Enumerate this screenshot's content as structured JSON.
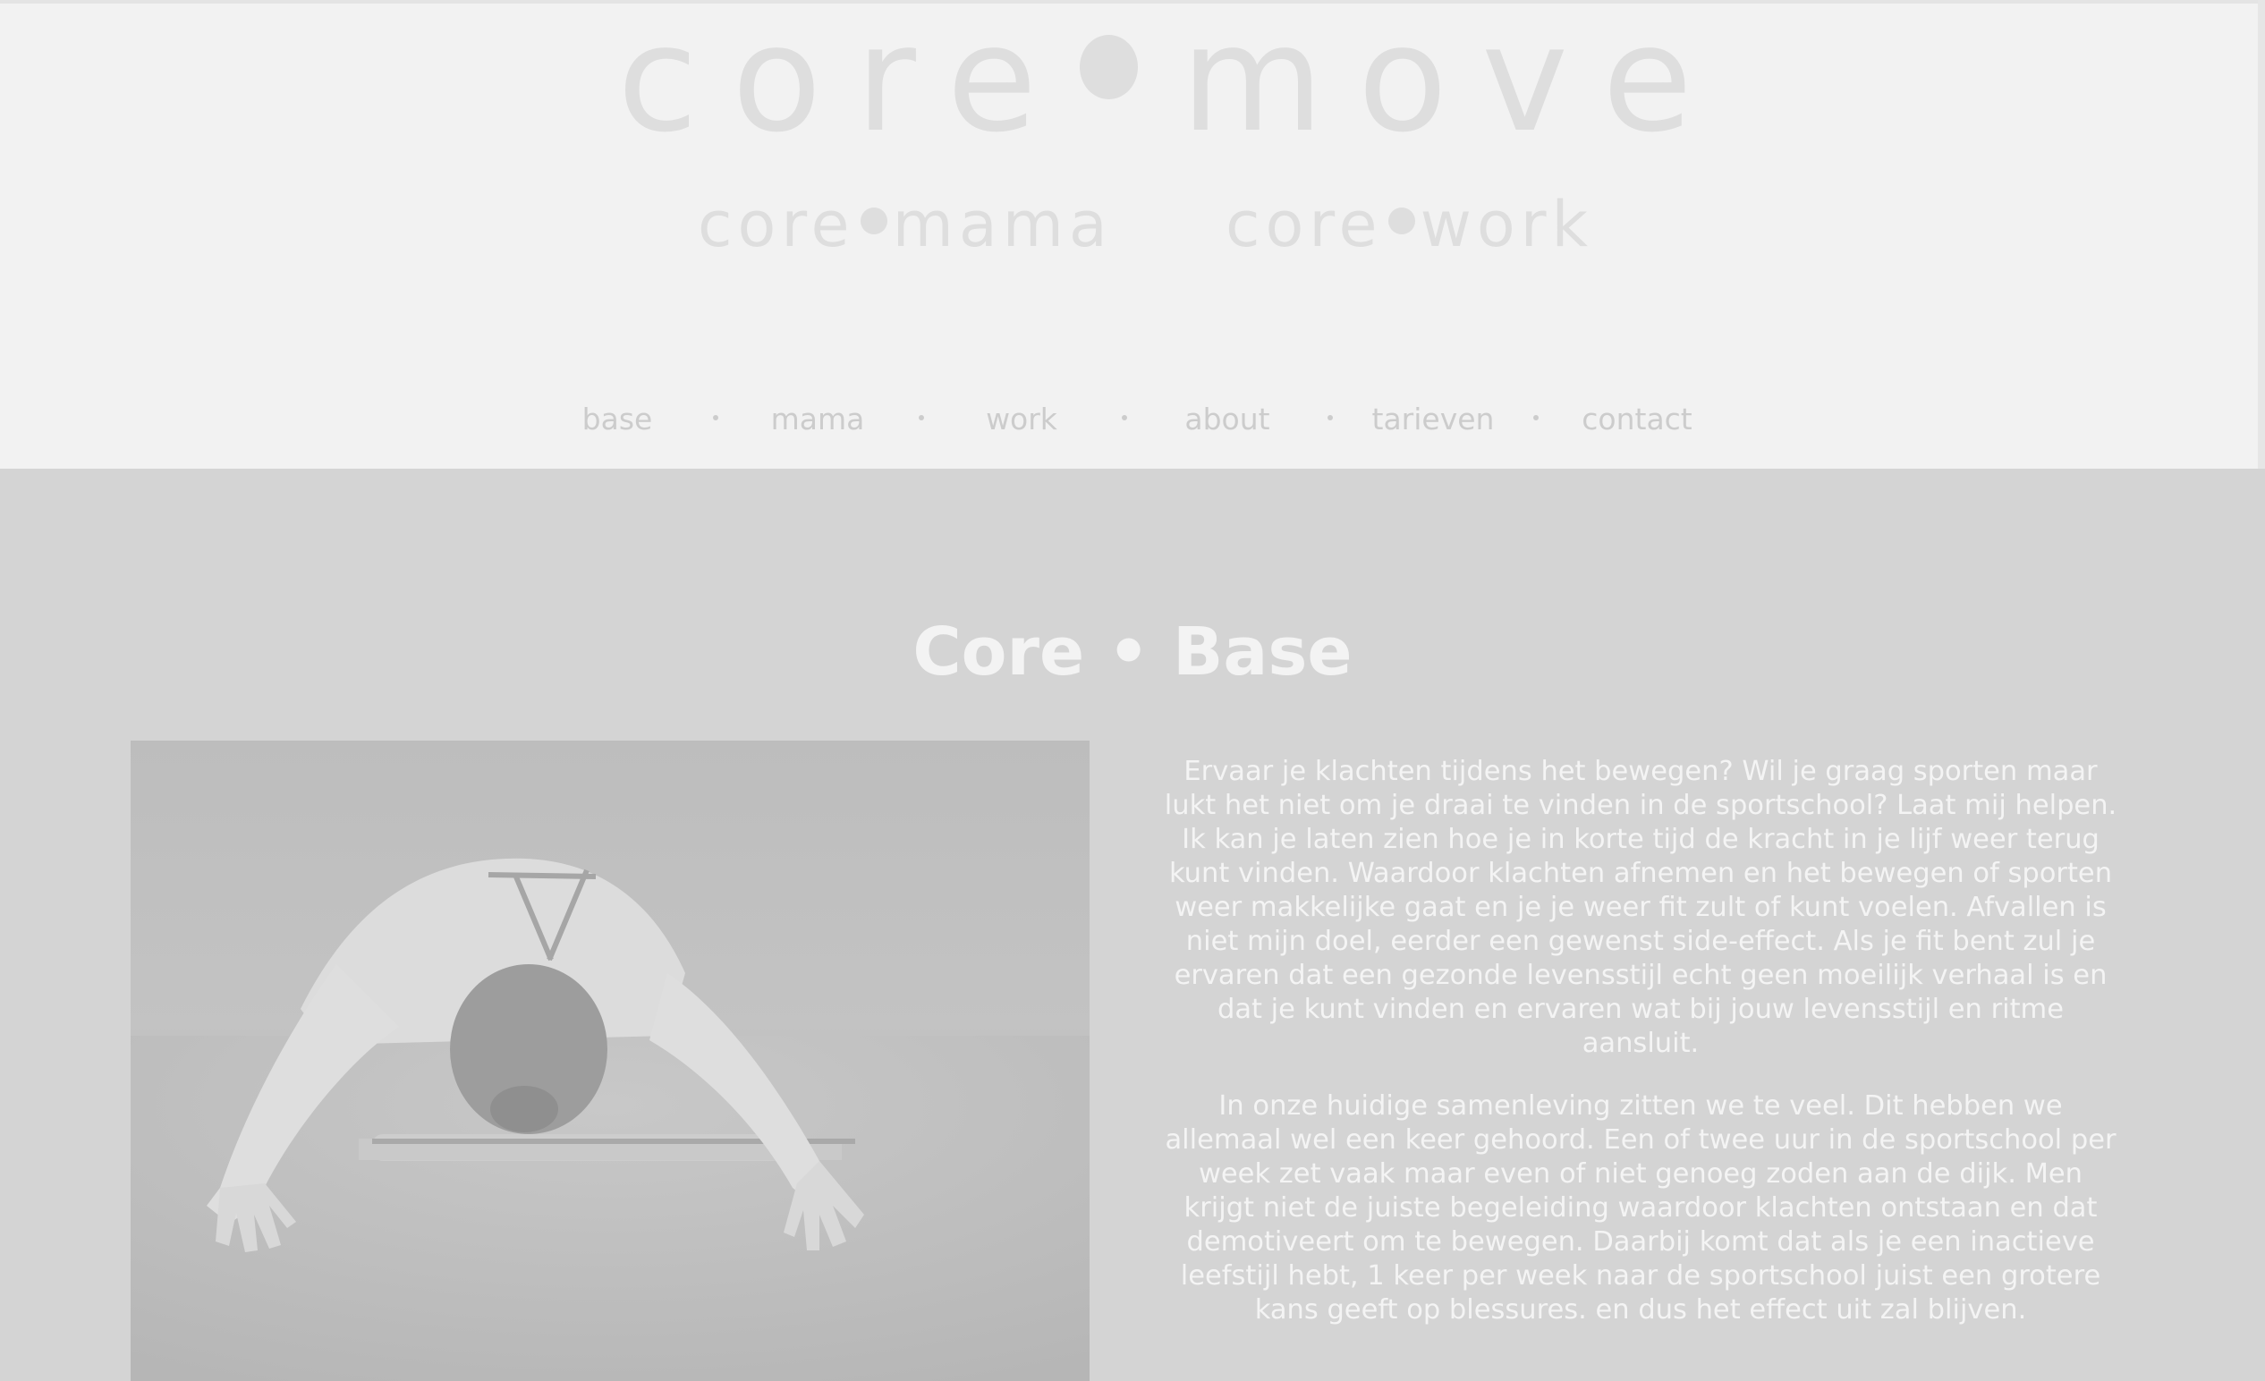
{
  "brand": {
    "logo_word_left": "core",
    "logo_word_right": "move",
    "sub_mama_left": "core",
    "sub_mama_right": "mama",
    "sub_work_left": "core",
    "sub_work_right": "work"
  },
  "nav": {
    "items": [
      {
        "label": "base"
      },
      {
        "label": "mama"
      },
      {
        "label": "work"
      },
      {
        "label": "about"
      },
      {
        "label": "tarieven"
      },
      {
        "label": "contact"
      }
    ]
  },
  "main": {
    "title": "Core • Base",
    "paragraphs": [
      "Ervaar je klachten tijdens het bewegen? Wil je graag sporten maar lukt het niet om je draai te vinden in de sportschool? Laat mij helpen. Ik kan je laten zien hoe je in korte tijd de kracht in je lijf weer terug kunt vinden. Waardoor klachten afnemen en het bewegen of sporten weer makkelijke gaat en je je weer fit zult of kunt voelen. Afvallen is niet mijn doel, eerder een gewenst side-effect. Als je fit bent zul je ervaren dat een gezonde levensstijl echt geen moeilijk verhaal is en dat je kunt vinden en ervaren wat bij jouw levensstijl en ritme aansluit.",
      "In onze huidige samenleving zitten we te veel. Dit hebben we allemaal wel een keer gehoord. Een of twee uur in de sportschool per week zet vaak maar even of niet genoeg zoden aan de dijk. Men krijgt niet de juiste begeleiding waardoor klachten ontstaan en dat demotiveert om te bewegen. Daarbij komt dat als je een inactieve leefstijl hebt, 1 keer per week naar de sportschool juist een grotere kans geeft op blessures. en dus het effect uit zal blijven."
    ]
  },
  "colors": {
    "header_bg": "#f2f2f2",
    "logo": "#dedede",
    "nav_text": "#cccccc",
    "main_bg": "#d4d4d4",
    "main_text": "#f4f4f4"
  }
}
